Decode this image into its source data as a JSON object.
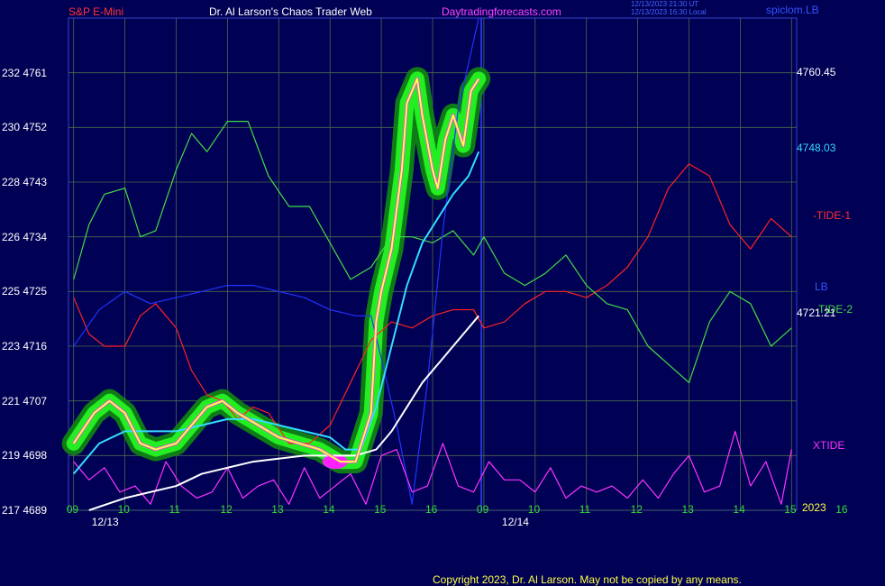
{
  "header": {
    "symbol": "S&P E-Mini",
    "title": "Dr. Al Larson's Chaos Trader Web",
    "site": "Daytradingforecasts.com",
    "timestamp_line1": "12/13/2023 21:30 UT",
    "timestamp_line2": "12/13/2023 16:30 Local",
    "corner_label": "spiclom.LB"
  },
  "footer": {
    "copyright": "Copyright 2023, Dr. Al Larson. May not be copied by any means."
  },
  "axes": {
    "y_left": [
      {
        "a": "232",
        "b": "4761"
      },
      {
        "a": "230",
        "b": "4752"
      },
      {
        "a": "228",
        "b": "4743"
      },
      {
        "a": "226",
        "b": "4734"
      },
      {
        "a": "225",
        "b": "4725"
      },
      {
        "a": "223",
        "b": "4716"
      },
      {
        "a": "221",
        "b": "4707"
      },
      {
        "a": "219",
        "b": "4698"
      },
      {
        "a": "217",
        "b": "4689"
      }
    ],
    "x_hours_day1": [
      "09",
      "10",
      "11",
      "12",
      "13",
      "14",
      "15",
      "16"
    ],
    "x_hours_day2": [
      "09",
      "10",
      "11",
      "12",
      "13",
      "14",
      "15",
      "16"
    ],
    "dates": [
      "12/13",
      "12/14"
    ],
    "year": "2023"
  },
  "right_labels": {
    "price": "4760.45",
    "cyan_value": "4748.03",
    "tide1": "-TIDE-1",
    "lb": "LB",
    "tide2": "-TIDE-2",
    "white_value": "4721.21",
    "xtide": "XTIDE"
  },
  "colors": {
    "background": "#000055",
    "grid": "#4a6a4a",
    "tide1": "#ff2222",
    "tide2": "#44dd44",
    "lb": "#2233ff",
    "xtide": "#ff33ff",
    "price": "#ffff44",
    "cyan": "#33ddff",
    "white": "#ffffff",
    "glow": "#22ee22"
  },
  "chart_data": {
    "type": "line",
    "title": "S&P E-Mini",
    "ylim": [
      4689,
      4770
    ],
    "x_unit": "trading hour (Dec 13 session, continuing to Dec 14 forecast)",
    "series": [
      {
        "name": "Price",
        "color": "#ffff44",
        "x": [
          8.0,
          8.4,
          8.7,
          9.0,
          9.3,
          9.6,
          10.0,
          10.3,
          10.6,
          10.9,
          11.2,
          11.6,
          12.0,
          12.4,
          12.8,
          13.2,
          13.5,
          13.8,
          13.9,
          14.0,
          14.2,
          14.4,
          14.5,
          14.7,
          14.8,
          15.0,
          15.1,
          15.25,
          15.4,
          15.6,
          15.75,
          15.9
        ],
        "y": [
          4700,
          4705,
          4707,
          4705,
          4700,
          4699,
          4700,
          4703,
          4706,
          4707,
          4705,
          4703,
          4701,
          4700,
          4699,
          4697,
          4697,
          4705,
          4720,
          4725,
          4732,
          4745,
          4756,
          4760,
          4754,
          4745,
          4742,
          4750,
          4754,
          4749,
          4758,
          4760
        ]
      },
      {
        "name": "",
        "color": "#33ddff",
        "x": [
          8.0,
          8.5,
          9.0,
          9.5,
          10.0,
          10.5,
          11.0,
          11.5,
          12.0,
          12.5,
          13.0,
          13.3,
          13.6,
          13.9,
          14.2,
          14.5,
          14.8,
          15.1,
          15.4,
          15.7,
          15.9
        ],
        "y": [
          4695,
          4700,
          4702,
          4702,
          4702,
          4703,
          4704,
          4704,
          4703,
          4702,
          4701,
          4699,
          4699,
          4706,
          4716,
          4726,
          4733,
          4737,
          4741,
          4744,
          4748
        ]
      },
      {
        "name": "",
        "color": "#ffffff",
        "x": [
          8.3,
          9.0,
          9.5,
          10.0,
          10.5,
          11.0,
          11.5,
          12.0,
          12.5,
          13.0,
          13.5,
          13.9,
          14.2,
          14.5,
          14.8,
          15.2,
          15.6,
          15.9
        ],
        "y": [
          4689,
          4691,
          4692,
          4693,
          4695,
          4696,
          4697,
          4697.5,
          4698,
          4698,
          4698,
          4699,
          4702,
          4706,
          4710,
          4714,
          4718,
          4721
        ]
      },
      {
        "name": "-TIDE-1",
        "color": "#ff2222",
        "x": [
          8.0,
          8.3,
          8.6,
          9.0,
          9.3,
          9.6,
          10.0,
          10.3,
          10.6,
          10.9,
          11.2,
          11.5,
          11.8,
          12.2,
          12.6,
          13.0,
          13.4,
          13.8,
          14.2,
          14.6,
          15.0,
          15.4,
          15.8,
          16.0,
          16.4,
          16.8,
          17.2,
          17.6,
          18.0,
          18.4,
          18.8,
          19.2,
          19.6,
          20.0,
          20.4,
          20.8,
          21.2,
          21.6,
          22.0
        ],
        "y": [
          4724,
          4718,
          4716,
          4716,
          4721,
          4723,
          4719,
          4712,
          4708,
          4707,
          4704,
          4706,
          4705,
          4700,
          4700,
          4703,
          4710,
          4717,
          4720,
          4719,
          4721,
          4722,
          4722,
          4719,
          4720,
          4723,
          4725,
          4725,
          4724,
          4726,
          4729,
          4734,
          4742,
          4746,
          4744,
          4736,
          4732,
          4737,
          4734
        ]
      },
      {
        "name": "-TIDE-2",
        "color": "#44dd44",
        "x": [
          8.0,
          8.3,
          8.6,
          9.0,
          9.3,
          9.6,
          10.0,
          10.3,
          10.6,
          11.0,
          11.4,
          11.8,
          12.2,
          12.6,
          13.0,
          13.4,
          13.8,
          14.2,
          14.6,
          15.0,
          15.4,
          15.8,
          16.0,
          16.4,
          16.8,
          17.2,
          17.6,
          18.0,
          18.4,
          18.8,
          19.2,
          19.6,
          20.0,
          20.4,
          20.8,
          21.2,
          21.6,
          22.0
        ],
        "y": [
          4727,
          4736,
          4741,
          4742,
          4734,
          4735,
          4745,
          4751,
          4748,
          4753,
          4753,
          4744,
          4739,
          4739,
          4733,
          4727,
          4729,
          4734,
          4734,
          4733,
          4735,
          4731,
          4734,
          4728,
          4726,
          4728,
          4731,
          4726,
          4723,
          4722,
          4716,
          4713,
          4710,
          4720,
          4725,
          4723,
          4716,
          4719
        ]
      },
      {
        "name": "LB",
        "color": "#2233ff",
        "x": [
          8.0,
          8.5,
          9.0,
          9.5,
          10.0,
          10.5,
          11.0,
          11.5,
          12.0,
          12.5,
          13.0,
          13.5,
          13.8,
          14.0,
          14.3,
          14.6,
          14.9,
          15.2,
          15.5,
          15.9
        ],
        "y": [
          4716,
          4722,
          4725,
          4723,
          4724,
          4725,
          4726,
          4726,
          4725,
          4724,
          4722,
          4721,
          4721,
          4714,
          4703,
          4690,
          4710,
          4735,
          4755,
          4770
        ]
      },
      {
        "name": "XTIDE",
        "color": "#ff33ff",
        "x": [
          8.0,
          8.3,
          8.6,
          8.9,
          9.2,
          9.5,
          9.8,
          10.1,
          10.4,
          10.7,
          11.0,
          11.3,
          11.6,
          11.9,
          12.2,
          12.5,
          12.8,
          13.1,
          13.4,
          13.7,
          14.0,
          14.3,
          14.6,
          14.9,
          15.2,
          15.5,
          15.8,
          16.1,
          16.4,
          16.7,
          17.0,
          17.3,
          17.6,
          17.9,
          18.2,
          18.5,
          18.8,
          19.1,
          19.4,
          19.7,
          20.0,
          20.3,
          20.6,
          20.9,
          21.2,
          21.5,
          21.8,
          22.0
        ],
        "y": [
          4697,
          4694,
          4696,
          4692,
          4693,
          4690,
          4697,
          4693,
          4691,
          4692,
          4696,
          4691,
          4693,
          4694,
          4690,
          4696,
          4691,
          4693,
          4695,
          4690,
          4698,
          4699,
          4692,
          4693,
          4700,
          4693,
          4692,
          4697,
          4694,
          4694,
          4692,
          4696,
          4691,
          4693,
          4692,
          4693,
          4691,
          4694,
          4691,
          4695,
          4698,
          4692,
          4693,
          4702,
          4693,
          4697,
          4690,
          4699
        ]
      }
    ]
  }
}
